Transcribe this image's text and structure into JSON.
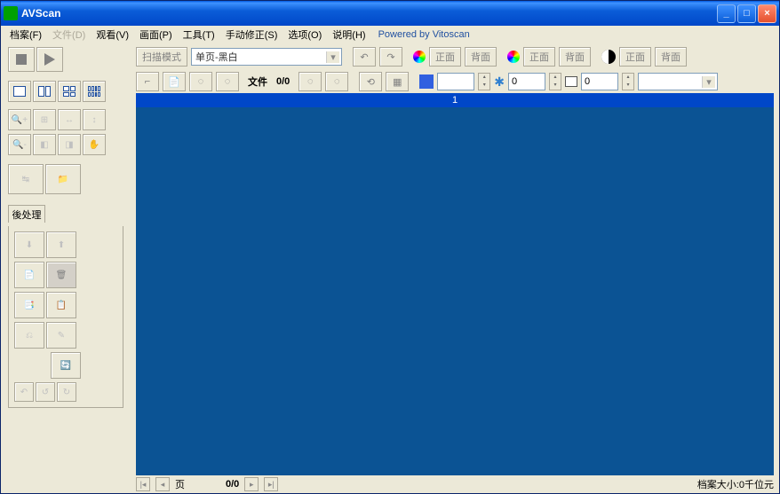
{
  "titlebar": {
    "app_name": "AVScan"
  },
  "menu": {
    "file": "档案(F)",
    "doc": "文件(D)",
    "view": "观看(V)",
    "page": "画面(P)",
    "tool": "工具(T)",
    "manual": "手动修正(S)",
    "options": "选项(O)",
    "help": "说明(H)",
    "powered": "Powered by Vitoscan"
  },
  "toolbar": {
    "scan_mode": "扫描模式",
    "mode_value": "单页-黑白",
    "front": "正面",
    "back": "背面",
    "file_label": "文件",
    "file_count": "0/0",
    "num1": "",
    "num2": "0",
    "num3": "0"
  },
  "left": {
    "grid_labels": [
      "1",
      "2",
      "4",
      "8"
    ],
    "post_tab": "後处理"
  },
  "canvas": {
    "header": "1"
  },
  "status": {
    "page_label": "页",
    "page_count": "0/0",
    "filesize": "档案大小:0千位元"
  }
}
